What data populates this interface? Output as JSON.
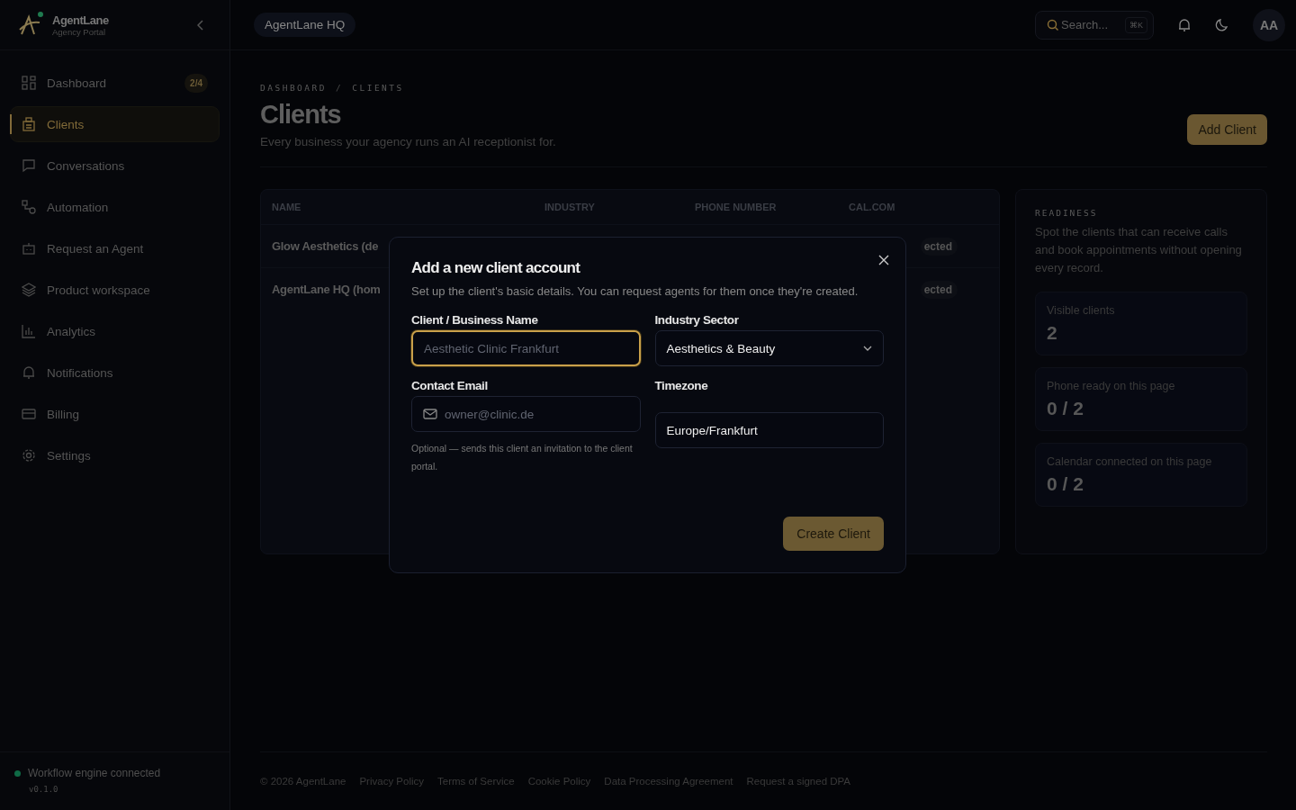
{
  "brand": {
    "name": "AgentLane",
    "subtitle": "Agency Portal"
  },
  "sidebar": {
    "items": [
      {
        "label": "Dashboard",
        "selected": false,
        "badge": "2/4"
      },
      {
        "label": "Clients",
        "selected": true
      },
      {
        "label": "Conversations",
        "selected": false
      },
      {
        "label": "Automation",
        "selected": false
      },
      {
        "label": "Request an Agent",
        "selected": false
      },
      {
        "label": "Product workspace",
        "selected": false
      },
      {
        "label": "Analytics",
        "selected": false
      },
      {
        "label": "Notifications",
        "selected": false
      },
      {
        "label": "Billing",
        "selected": false
      },
      {
        "label": "Settings",
        "selected": false
      }
    ],
    "status": "Workflow engine connected",
    "version": "v0.1.0"
  },
  "topbar": {
    "workspace": "AgentLane HQ",
    "search_placeholder": "Search...",
    "shortcut": "⌘K",
    "avatar": "AA"
  },
  "breadcrumb": [
    "DASHBOARD",
    "CLIENTS"
  ],
  "breadcrumb_separator": "/",
  "page": {
    "title": "Clients",
    "subtitle": "Every business your agency runs an AI receptionist for.",
    "add_button": "Add Client"
  },
  "table": {
    "columns": [
      "NAME",
      "INDUSTRY",
      "PHONE NUMBER",
      "CAL.COM"
    ],
    "rows": [
      {
        "name": "Glow Aesthetics (de",
        "status": "ected"
      },
      {
        "name": "AgentLane HQ (hom",
        "status": "ected"
      }
    ]
  },
  "readiness": {
    "label": "READINESS",
    "text": "Spot the clients that can receive calls and book appointments without opening every record.",
    "stats": [
      {
        "label": "Visible clients",
        "value": "2"
      },
      {
        "label": "Phone ready on this page",
        "value": "0 / 2"
      },
      {
        "label": "Calendar connected on this page",
        "value": "0 / 2"
      }
    ]
  },
  "footer": [
    "© 2026 AgentLane",
    "Privacy Policy",
    "Terms of Service",
    "Cookie Policy",
    "Data Processing Agreement",
    "Request a signed DPA"
  ],
  "modal": {
    "title": "Add a new client account",
    "text": "Set up the client's basic details. You can request agents for them once they're created.",
    "name_label": "Client / Business Name",
    "name_placeholder": "Aesthetic Clinic Frankfurt",
    "industry_label": "Industry Sector",
    "industry_value": "Aesthetics & Beauty",
    "email_label": "Contact Email",
    "email_placeholder": "owner@clinic.de",
    "email_hint": "Optional — sends this client an invitation to the client portal.",
    "timezone_label": "Timezone",
    "timezone_value": "Europe/Frankfurt",
    "create_button": "Create Client"
  }
}
